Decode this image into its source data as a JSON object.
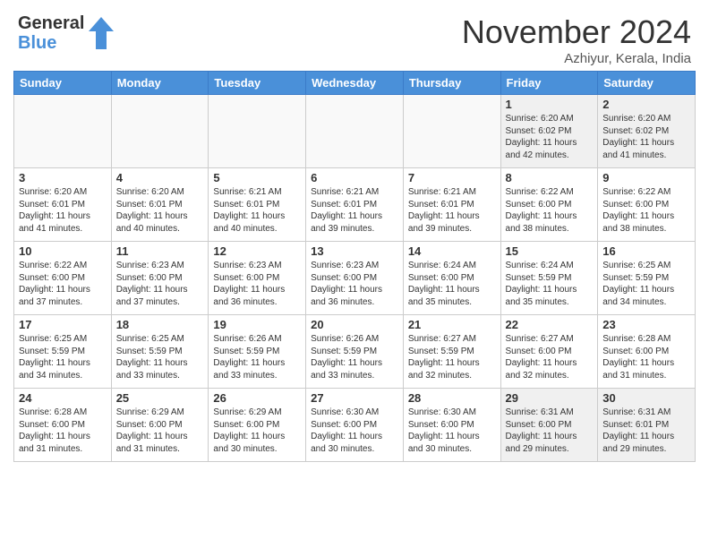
{
  "header": {
    "logo_general": "General",
    "logo_blue": "Blue",
    "month_title": "November 2024",
    "location": "Azhiyur, Kerala, India"
  },
  "weekdays": [
    "Sunday",
    "Monday",
    "Tuesday",
    "Wednesday",
    "Thursday",
    "Friday",
    "Saturday"
  ],
  "weeks": [
    [
      {
        "day": "",
        "info": ""
      },
      {
        "day": "",
        "info": ""
      },
      {
        "day": "",
        "info": ""
      },
      {
        "day": "",
        "info": ""
      },
      {
        "day": "",
        "info": ""
      },
      {
        "day": "1",
        "info": "Sunrise: 6:20 AM\nSunset: 6:02 PM\nDaylight: 11 hours and 42 minutes."
      },
      {
        "day": "2",
        "info": "Sunrise: 6:20 AM\nSunset: 6:02 PM\nDaylight: 11 hours and 41 minutes."
      }
    ],
    [
      {
        "day": "3",
        "info": "Sunrise: 6:20 AM\nSunset: 6:01 PM\nDaylight: 11 hours and 41 minutes."
      },
      {
        "day": "4",
        "info": "Sunrise: 6:20 AM\nSunset: 6:01 PM\nDaylight: 11 hours and 40 minutes."
      },
      {
        "day": "5",
        "info": "Sunrise: 6:21 AM\nSunset: 6:01 PM\nDaylight: 11 hours and 40 minutes."
      },
      {
        "day": "6",
        "info": "Sunrise: 6:21 AM\nSunset: 6:01 PM\nDaylight: 11 hours and 39 minutes."
      },
      {
        "day": "7",
        "info": "Sunrise: 6:21 AM\nSunset: 6:01 PM\nDaylight: 11 hours and 39 minutes."
      },
      {
        "day": "8",
        "info": "Sunrise: 6:22 AM\nSunset: 6:00 PM\nDaylight: 11 hours and 38 minutes."
      },
      {
        "day": "9",
        "info": "Sunrise: 6:22 AM\nSunset: 6:00 PM\nDaylight: 11 hours and 38 minutes."
      }
    ],
    [
      {
        "day": "10",
        "info": "Sunrise: 6:22 AM\nSunset: 6:00 PM\nDaylight: 11 hours and 37 minutes."
      },
      {
        "day": "11",
        "info": "Sunrise: 6:23 AM\nSunset: 6:00 PM\nDaylight: 11 hours and 37 minutes."
      },
      {
        "day": "12",
        "info": "Sunrise: 6:23 AM\nSunset: 6:00 PM\nDaylight: 11 hours and 36 minutes."
      },
      {
        "day": "13",
        "info": "Sunrise: 6:23 AM\nSunset: 6:00 PM\nDaylight: 11 hours and 36 minutes."
      },
      {
        "day": "14",
        "info": "Sunrise: 6:24 AM\nSunset: 6:00 PM\nDaylight: 11 hours and 35 minutes."
      },
      {
        "day": "15",
        "info": "Sunrise: 6:24 AM\nSunset: 5:59 PM\nDaylight: 11 hours and 35 minutes."
      },
      {
        "day": "16",
        "info": "Sunrise: 6:25 AM\nSunset: 5:59 PM\nDaylight: 11 hours and 34 minutes."
      }
    ],
    [
      {
        "day": "17",
        "info": "Sunrise: 6:25 AM\nSunset: 5:59 PM\nDaylight: 11 hours and 34 minutes."
      },
      {
        "day": "18",
        "info": "Sunrise: 6:25 AM\nSunset: 5:59 PM\nDaylight: 11 hours and 33 minutes."
      },
      {
        "day": "19",
        "info": "Sunrise: 6:26 AM\nSunset: 5:59 PM\nDaylight: 11 hours and 33 minutes."
      },
      {
        "day": "20",
        "info": "Sunrise: 6:26 AM\nSunset: 5:59 PM\nDaylight: 11 hours and 33 minutes."
      },
      {
        "day": "21",
        "info": "Sunrise: 6:27 AM\nSunset: 5:59 PM\nDaylight: 11 hours and 32 minutes."
      },
      {
        "day": "22",
        "info": "Sunrise: 6:27 AM\nSunset: 6:00 PM\nDaylight: 11 hours and 32 minutes."
      },
      {
        "day": "23",
        "info": "Sunrise: 6:28 AM\nSunset: 6:00 PM\nDaylight: 11 hours and 31 minutes."
      }
    ],
    [
      {
        "day": "24",
        "info": "Sunrise: 6:28 AM\nSunset: 6:00 PM\nDaylight: 11 hours and 31 minutes."
      },
      {
        "day": "25",
        "info": "Sunrise: 6:29 AM\nSunset: 6:00 PM\nDaylight: 11 hours and 31 minutes."
      },
      {
        "day": "26",
        "info": "Sunrise: 6:29 AM\nSunset: 6:00 PM\nDaylight: 11 hours and 30 minutes."
      },
      {
        "day": "27",
        "info": "Sunrise: 6:30 AM\nSunset: 6:00 PM\nDaylight: 11 hours and 30 minutes."
      },
      {
        "day": "28",
        "info": "Sunrise: 6:30 AM\nSunset: 6:00 PM\nDaylight: 11 hours and 30 minutes."
      },
      {
        "day": "29",
        "info": "Sunrise: 6:31 AM\nSunset: 6:00 PM\nDaylight: 11 hours and 29 minutes."
      },
      {
        "day": "30",
        "info": "Sunrise: 6:31 AM\nSunset: 6:01 PM\nDaylight: 11 hours and 29 minutes."
      }
    ]
  ]
}
